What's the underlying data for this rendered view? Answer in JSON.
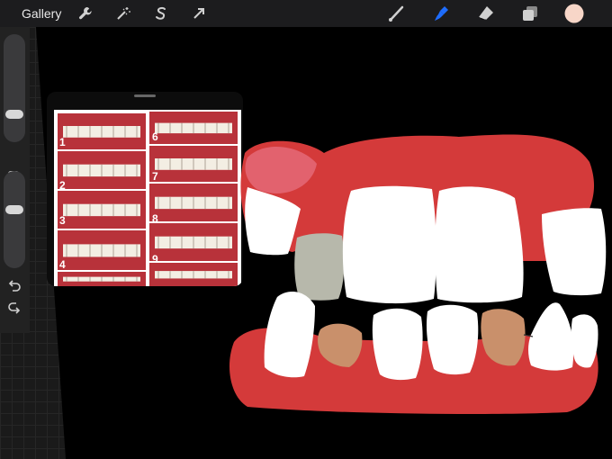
{
  "toolbar": {
    "gallery_label": "Gallery",
    "left_tools": [
      "wrench-icon",
      "magic-wand-icon",
      "selection-s-icon",
      "transform-arrow-icon"
    ],
    "right_tools": [
      "brush-icon",
      "smudge-icon",
      "eraser-icon",
      "layers-icon"
    ],
    "active_tool": "smudge",
    "active_tool_color": "#1e6dff",
    "current_color": "#f7d6c8"
  },
  "sidebar": {
    "brush_size": 0.27,
    "brush_opacity": 0.43,
    "modify_icon": "square-icon",
    "undo_icon": "undo-arrow-icon",
    "redo_icon": "redo-arrow-icon"
  },
  "reference": {
    "labels": [
      "1",
      "2",
      "3",
      "4",
      "6",
      "7",
      "8",
      "9"
    ]
  },
  "colors": {
    "gum": "#d43a3a",
    "tooth": "#ffffff",
    "grey_tooth": "#b7b8ab",
    "brown_tooth": "#c9906b"
  }
}
